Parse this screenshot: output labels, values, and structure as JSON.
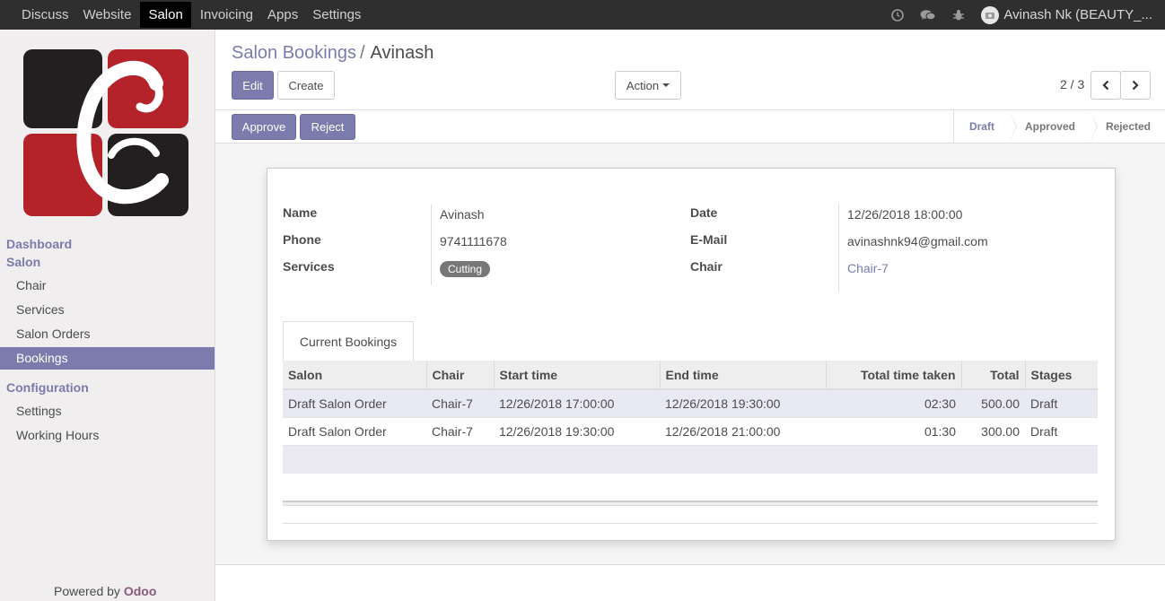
{
  "topnav": {
    "menus": [
      "Discuss",
      "Website",
      "Salon",
      "Invoicing",
      "Apps",
      "Settings"
    ],
    "active_menu": "Salon",
    "user_label": "Avinash Nk (BEAUTY_..."
  },
  "sidebar": {
    "section_dashboard": "Dashboard",
    "section_salon": "Salon",
    "salon_items": [
      "Chair",
      "Services",
      "Salon Orders",
      "Bookings"
    ],
    "active_item": "Bookings",
    "section_configuration": "Configuration",
    "config_items": [
      "Settings",
      "Working Hours"
    ],
    "powered_prefix": "Powered by",
    "powered_brand": "Odoo"
  },
  "breadcrumb": {
    "parent": "Salon Bookings",
    "separator": "/",
    "current": "Avinash"
  },
  "buttons": {
    "edit": "Edit",
    "create": "Create",
    "action": "Action",
    "approve": "Approve",
    "reject": "Reject"
  },
  "pager": {
    "value": "2 / 3"
  },
  "stages": [
    "Draft",
    "Approved",
    "Rejected"
  ],
  "current_stage": "Draft",
  "form": {
    "name_label": "Name",
    "name_value": "Avinash",
    "phone_label": "Phone",
    "phone_value": "9741111678",
    "services_label": "Services",
    "services_tag": "Cutting",
    "date_label": "Date",
    "date_value": "12/26/2018 18:00:00",
    "email_label": "E-Mail",
    "email_value": "avinashnk94@gmail.com",
    "chair_label": "Chair",
    "chair_value": "Chair-7"
  },
  "tab": {
    "label": "Current Bookings"
  },
  "bookings_table": {
    "columns": [
      "Salon",
      "Chair",
      "Start time",
      "End time",
      "Total time taken",
      "Total",
      "Stages"
    ],
    "rows": [
      [
        "Draft Salon Order",
        "Chair-7",
        "12/26/2018 17:00:00",
        "12/26/2018 19:30:00",
        "02:30",
        "500.00",
        "Draft"
      ],
      [
        "Draft Salon Order",
        "Chair-7",
        "12/26/2018 19:30:00",
        "12/26/2018 21:00:00",
        "01:30",
        "300.00",
        "Draft"
      ]
    ]
  },
  "colors": {
    "accent": "#7c7bad",
    "topbar": "#2f2f2f",
    "logo_red": "#b5232a",
    "logo_dark": "#231f20"
  }
}
